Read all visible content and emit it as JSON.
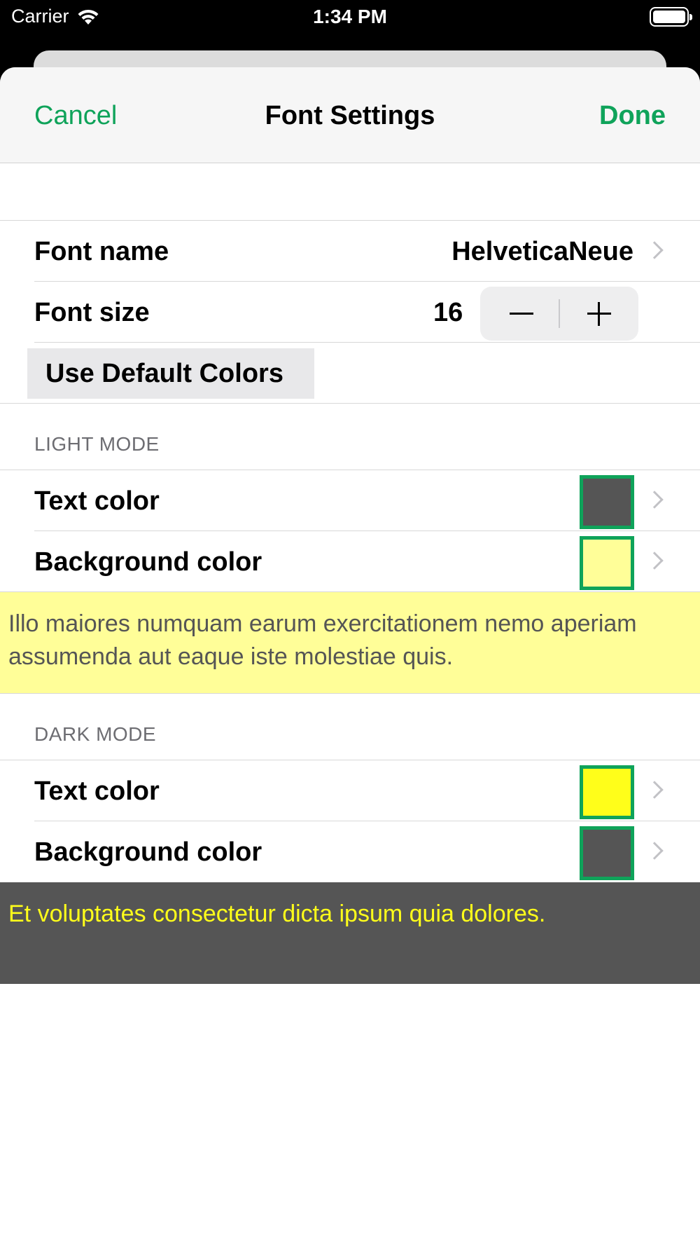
{
  "status_bar": {
    "carrier": "Carrier",
    "time": "1:34 PM"
  },
  "nav": {
    "cancel_label": "Cancel",
    "title": "Font Settings",
    "done_label": "Done"
  },
  "font": {
    "name_label": "Font name",
    "name_value": "HelveticaNeue",
    "size_label": "Font size",
    "size_value": "16",
    "default_colors_label": "Use Default Colors"
  },
  "light_mode": {
    "header": "LIGHT MODE",
    "text_color_label": "Text color",
    "text_color": "#555555",
    "background_color_label": "Background color",
    "background_color": "#fffe98",
    "preview_text": "Illo maiores numquam earum exercitationem nemo aperiam assumenda aut eaque iste molestiae quis."
  },
  "dark_mode": {
    "header": "DARK MODE",
    "text_color_label": "Text color",
    "text_color": "#fffe1a",
    "background_color_label": "Background color",
    "background_color": "#555555",
    "preview_text": "Et voluptates consectetur dicta ipsum quia dolores."
  },
  "colors": {
    "accent": "#0fa35a",
    "swatch_border": "#0fa35a"
  },
  "icons": {
    "wifi": "wifi-icon",
    "battery": "battery-icon",
    "chevron": "chevron-right-icon",
    "minus": "minus-icon",
    "plus": "plus-icon"
  }
}
